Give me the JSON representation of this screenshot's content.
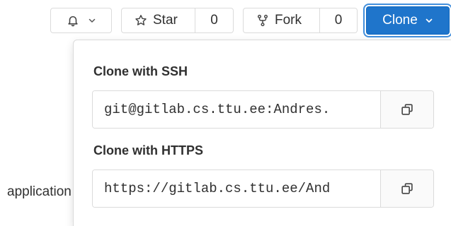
{
  "header": {
    "notification": {
      "icon": "bell-icon",
      "caret_icon": "chevron-down-icon"
    },
    "star": {
      "icon": "star-icon",
      "label": "Star",
      "count": "0"
    },
    "fork": {
      "icon": "fork-icon",
      "label": "Fork",
      "count": "0"
    },
    "clone": {
      "label": "Clone",
      "caret_icon": "chevron-down-icon",
      "color": "#1f75cb"
    }
  },
  "background": {
    "partial_text": "application"
  },
  "clone_dropdown": {
    "ssh": {
      "title": "Clone with SSH",
      "value": "git@gitlab.cs.ttu.ee:Andres.",
      "copy_icon": "copy-icon"
    },
    "https": {
      "title": "Clone with HTTPS",
      "value": "https://gitlab.cs.ttu.ee/And",
      "copy_icon": "copy-icon"
    }
  }
}
